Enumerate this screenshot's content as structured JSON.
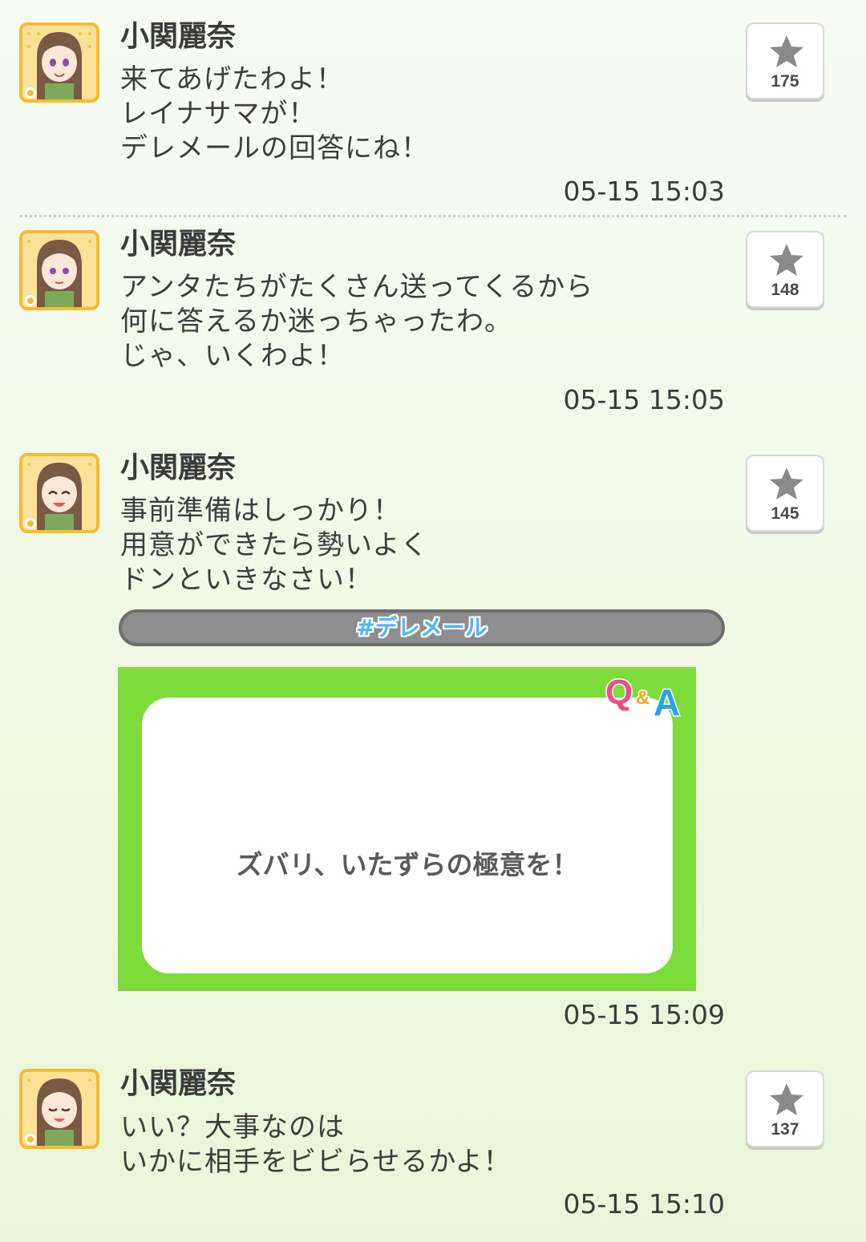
{
  "posts": [
    {
      "author": "小関麗奈",
      "lines": [
        "来てあげたわよ！",
        "レイナサマが！",
        "デレメールの回答にね！"
      ],
      "time": "05-15 15:03",
      "stars": "175"
    },
    {
      "author": "小関麗奈",
      "lines": [
        "アンタたちがたくさん送ってくるから",
        "何に答えるか迷っちゃったわ。",
        "じゃ、いくわよ！"
      ],
      "time": "05-15 15:05",
      "stars": "148"
    },
    {
      "author": "小関麗奈",
      "lines": [
        "事前準備はしっかり！",
        "用意ができたら勢いよく",
        "ドンといきなさい！"
      ],
      "hashtag": "#デレメール",
      "qa_badge": "Q&A",
      "qa_question": "ズバリ、いたずらの極意を！",
      "time": "05-15 15:09",
      "stars": "145"
    },
    {
      "author": "小関麗奈",
      "lines": [
        "いい？大事なのは",
        "いかに相手をビビらせるかよ！"
      ],
      "time": "05-15 15:10",
      "stars": "137"
    }
  ],
  "icons": {
    "avatar": "character-portrait-icon",
    "star": "star-icon"
  },
  "colors": {
    "avatar_frame": "#f3bd33",
    "qa_frame": "#7ddc3c",
    "hashtag_text": "#4fb5ff",
    "hashtag_bar": "#8e8e8e"
  }
}
